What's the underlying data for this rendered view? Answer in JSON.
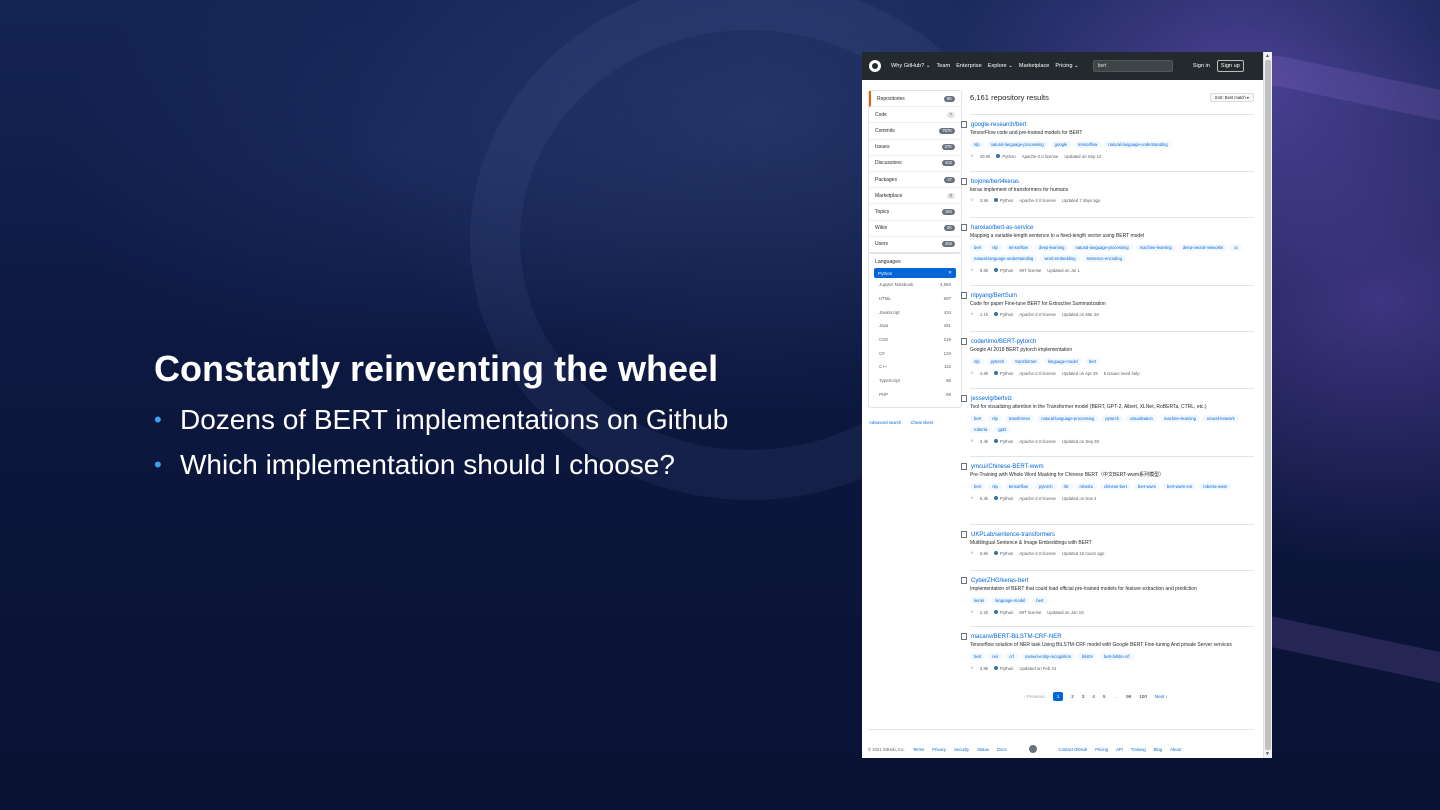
{
  "slide": {
    "title": "Constantly reinventing the wheel",
    "bullets": [
      "Dozens of BERT implementations on Github",
      "Which implementation should I choose?"
    ]
  },
  "colors": {
    "accent": "#3aa0f0",
    "link": "#0366d6",
    "header": "#24292e"
  },
  "header": {
    "nav": [
      "Why GitHub? ⌄",
      "Team",
      "Enterprise",
      "Explore ⌄",
      "Marketplace",
      "Pricing ⌄"
    ],
    "search_value": "bert",
    "signin": "Sign in",
    "signup": "Sign up"
  },
  "sidebar": {
    "items": [
      {
        "label": "Repositories",
        "count": "6K"
      },
      {
        "label": "Code",
        "count": "?"
      },
      {
        "label": "Commits",
        "count": "787K"
      },
      {
        "label": "Issues",
        "count": "37K"
      },
      {
        "label": "Discussions",
        "count": "402"
      },
      {
        "label": "Packages",
        "count": "27"
      },
      {
        "label": "Marketplace",
        "count": "0"
      },
      {
        "label": "Topics",
        "count": "164"
      },
      {
        "label": "Wikis",
        "count": "2K"
      },
      {
        "label": "Users",
        "count": "464"
      }
    ],
    "languages_title": "Languages",
    "selected_language": "Python",
    "languages": [
      {
        "name": "Jupyter Notebook",
        "count": "4,584"
      },
      {
        "name": "HTML",
        "count": "697"
      },
      {
        "name": "JavaScript",
        "count": "434"
      },
      {
        "name": "Java",
        "count": "281"
      },
      {
        "name": "CSS",
        "count": "219"
      },
      {
        "name": "C#",
        "count": "134"
      },
      {
        "name": "C++",
        "count": "116"
      },
      {
        "name": "TypeScript",
        "count": "86"
      },
      {
        "name": "PHP",
        "count": "69"
      }
    ],
    "advanced_search": "Advanced search",
    "cheat_sheet": "Cheat sheet"
  },
  "main": {
    "result_count": "6,161 repository results",
    "sort_label": "Sort: Best match ▾",
    "repos": [
      {
        "name": "google-research/bert",
        "desc": "TensorFlow code and pre-trained models for BERT",
        "topics": [
          "nlp",
          "natural-language-processing",
          "google",
          "tensorflow",
          "natural-language-understanding"
        ],
        "stars": "29.0k",
        "lang": "Python",
        "license": "Apache-2.0 license",
        "updated": "Updated on Sep 12",
        "extra": ""
      },
      {
        "name": "bojone/bert4keras",
        "desc": "keras implement of transformers for humans",
        "topics": [],
        "stars": "3.9k",
        "lang": "Python",
        "license": "Apache-2.0 license",
        "updated": "Updated 7 days ago",
        "extra": ""
      },
      {
        "name": "hanxiao/bert-as-service",
        "desc": "Mapping a variable-length sentence to a fixed-length vector using BERT model",
        "topics": [
          "bert",
          "nlp",
          "tensorflow",
          "deep-learning",
          "natural-language-processing",
          "machine-learning",
          "deep-neural-networks",
          "ai",
          "natural-language-understanding",
          "word-embedding",
          "sentence-encoding"
        ],
        "stars": "9.8k",
        "lang": "Python",
        "license": "MIT license",
        "updated": "Updated on Jul 1",
        "extra": ""
      },
      {
        "name": "nlpyang/BertSum",
        "desc": "Code for paper Fine-tune BERT for Extractive Summarization",
        "topics": [],
        "stars": "1.1k",
        "lang": "Python",
        "license": "Apache-2.0 license",
        "updated": "Updated on Mar 28",
        "extra": ""
      },
      {
        "name": "codertimo/BERT-pytorch",
        "desc": "Google AI 2018 BERT pytorch implementation",
        "topics": [
          "nlp",
          "pytorch",
          "transformer",
          "language-model",
          "bert"
        ],
        "stars": "4.8k",
        "lang": "Python",
        "license": "Apache-2.0 license",
        "updated": "Updated on Apr 25",
        "extra": "5 issues need help"
      },
      {
        "name": "jessevig/bertviz",
        "desc": "Tool for visualizing attention in the Transformer model (BERT, GPT-2, Albert, XLNet, RoBERTa, CTRL, etc.)",
        "topics": [
          "bert",
          "nlp",
          "transformer",
          "natural-language-processing",
          "pytorch",
          "visualization",
          "machine-learning",
          "neural-network",
          "roberta",
          "gpt2"
        ],
        "stars": "3.4k",
        "lang": "Python",
        "license": "Apache-2.0 license",
        "updated": "Updated on Sep 30",
        "extra": ""
      },
      {
        "name": "ymcui/Chinese-BERT-wwm",
        "desc": "Pre-Training with Whole Word Masking for Chinese BERT（中文BERT-wwm系列模型）",
        "topics": [
          "bert",
          "nlp",
          "tensorflow",
          "pytorch",
          "rbt",
          "roberta",
          "chinese-bert",
          "bert-wwm",
          "bert-wwm-ext",
          "roberta-wwm"
        ],
        "stars": "6.3k",
        "lang": "Python",
        "license": "Apache-2.0 license",
        "updated": "Updated on Nov 4",
        "extra": ""
      },
      {
        "name": "UKPLab/sentence-transformers",
        "desc": "Multilingual Sentence & Image Embeddings with BERT",
        "topics": [],
        "stars": "6.8k",
        "lang": "Python",
        "license": "Apache-2.0 license",
        "updated": "Updated 15 hours ago",
        "extra": ""
      },
      {
        "name": "CyberZHG/keras-bert",
        "desc": "Implementation of BERT that could load official pre-trained models for feature extraction and prediction",
        "topics": [
          "keras",
          "language-model",
          "bert"
        ],
        "stars": "2.2k",
        "lang": "Python",
        "license": "MIT license",
        "updated": "Updated on Jun 19",
        "extra": ""
      },
      {
        "name": "macanv/BERT-BiLSTM-CRF-NER",
        "desc": "Tensorflow solution of NER task Using BiLSTM-CRF model with Google BERT Fine-tuning And private Server services",
        "topics": [
          "bert",
          "ner",
          "crf",
          "named-entity-recognition",
          "bilstm",
          "bert-bilstm-crf"
        ],
        "stars": "3.8k",
        "lang": "Python",
        "license": "",
        "updated": "Updated on Feb 24",
        "extra": ""
      }
    ]
  },
  "pager": {
    "prev": "‹ Previous",
    "pages": [
      "1",
      "2",
      "3",
      "4",
      "5",
      "…",
      "99",
      "100"
    ],
    "next": "Next ›"
  },
  "footer": {
    "copy": "© 2021 GitHub, Inc.",
    "left_links": [
      "Terms",
      "Privacy",
      "Security",
      "Status",
      "Docs"
    ],
    "right_links": [
      "Contact GitHub",
      "Pricing",
      "API",
      "Training",
      "Blog",
      "About"
    ]
  }
}
